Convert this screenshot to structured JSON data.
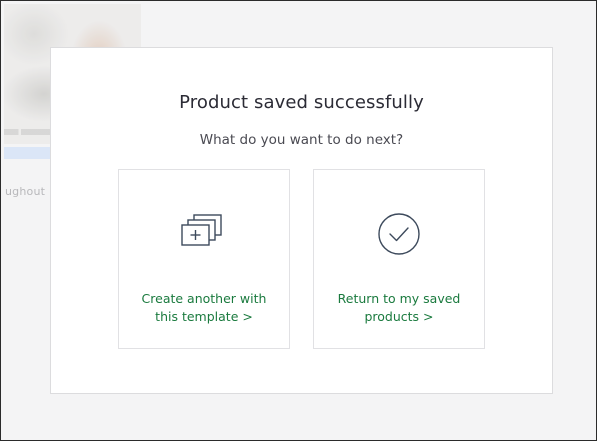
{
  "background": {
    "partial_text": "ughout"
  },
  "modal": {
    "title": "Product saved successfully",
    "subtitle": "What do you want to do next?",
    "options": [
      {
        "label_line1": "Create another with",
        "label_line2": "this template >",
        "icon": "duplicate-add-icon"
      },
      {
        "label_line1": "Return to my saved",
        "label_line2": "products >",
        "icon": "check-circle-icon"
      }
    ]
  },
  "colors": {
    "accent_green": "#1a7a3e",
    "icon_stroke": "#3d4a5c",
    "title_text": "#2b2b35"
  }
}
